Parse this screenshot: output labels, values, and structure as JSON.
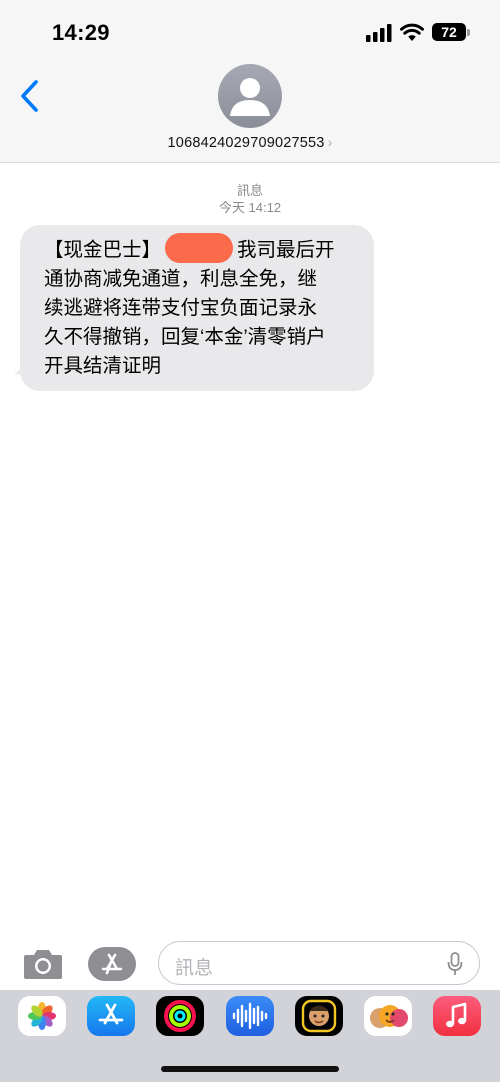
{
  "status_bar": {
    "time": "14:29",
    "battery": "72",
    "icons": [
      "signal-icon",
      "wifi-icon",
      "battery-icon"
    ]
  },
  "header": {
    "contact": "1068424029709027553",
    "back_icon": "chevron-left-icon",
    "contact_chevron": "›"
  },
  "thread": {
    "service_label": "訊息",
    "timestamp": "今天 14:12",
    "messages": [
      {
        "direction": "incoming",
        "lines": [
          "【现金巴士】",
          "我司最后开",
          "通协商减免通道，利息全免，继",
          "续逃避将连带支付宝负面记录永",
          "久不得撤销，回复‘本金’清零销户",
          "开具结清证明"
        ]
      }
    ]
  },
  "composer": {
    "placeholder": "訊息",
    "icons": [
      "camera-icon",
      "app-store-icon",
      "microphone-icon"
    ]
  },
  "app_drawer": {
    "apps": [
      "photos-icon",
      "app-store-icon",
      "fitness-icon",
      "audio-message-icon",
      "memoji-icon",
      "animoji-icon",
      "music-icon"
    ]
  },
  "colors": {
    "accent": "#007aff",
    "bubble_incoming": "#e9e9eb",
    "redaction": "#fb6a4b",
    "header_bg": "#f6f6f6",
    "app_drawer_bg": "#d1d3d9"
  }
}
